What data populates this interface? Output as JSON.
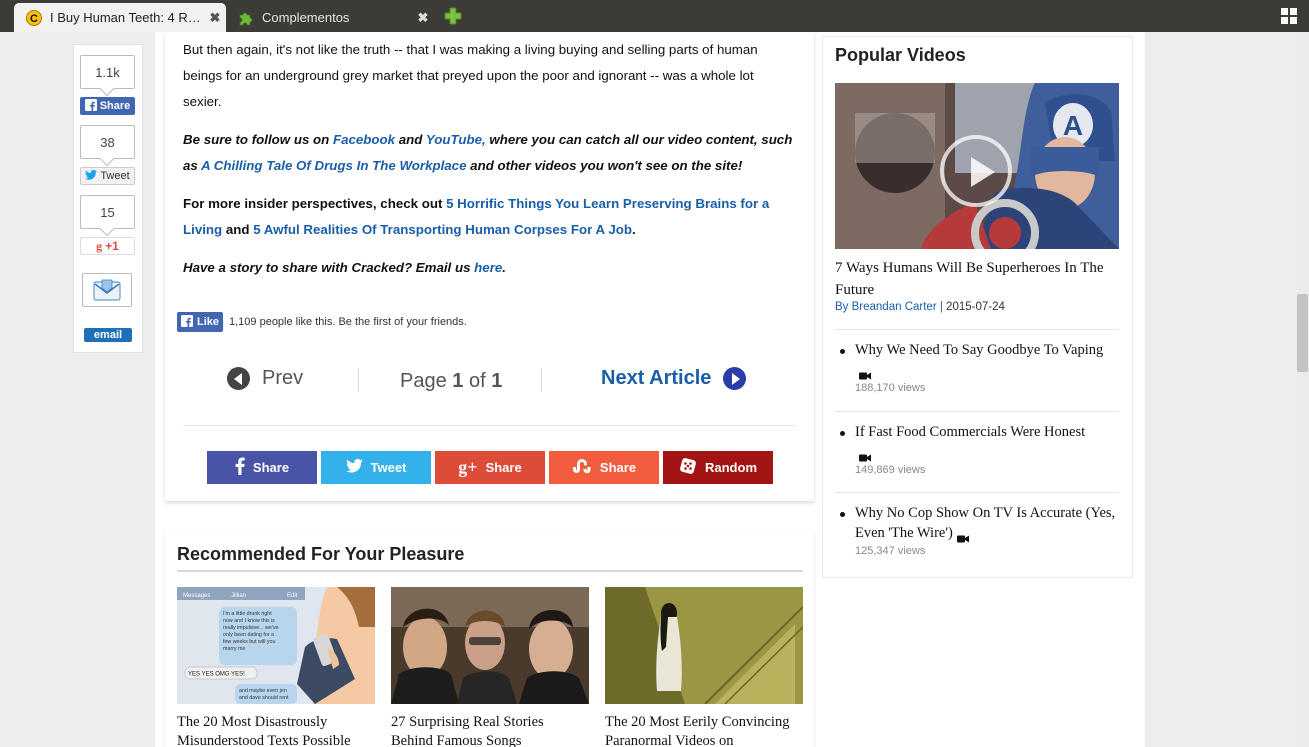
{
  "browser": {
    "tabs": [
      {
        "title": "I Buy Human Teeth: 4 Re...",
        "active": true
      },
      {
        "title": "Complementos",
        "active": false
      }
    ],
    "close_glyph": "✖"
  },
  "share_rail": {
    "facebook": {
      "count": "1.1k",
      "label": "Share"
    },
    "twitter": {
      "count": "38",
      "label": "Tweet"
    },
    "gplus": {
      "count": "15",
      "label": "+1"
    },
    "email": {
      "label": "email"
    }
  },
  "article": {
    "para1": "But then again, it's not like the truth -- that I was making a living buying and selling parts of human beings for an underground grey market that preyed upon the poor and ignorant -- was a whole lot sexier.",
    "follow": {
      "t1": "Be sure to follow us on ",
      "facebook": "Facebook",
      "t2": " and ",
      "youtube": "YouTube,",
      "t3": " where you can catch all our video content, such as ",
      "video": "A Chilling Tale Of Drugs In The Workplace",
      "t4": " and other videos you won't see on the site!"
    },
    "insider": {
      "t1": "For more insider perspectives, check out ",
      "link1": "5 Horrific Things You Learn Preserving Brains for a Living",
      "t2": " and ",
      "link2": "5 Awful Realities Of Transporting Human Corpses For A Job",
      "t3": "."
    },
    "story": {
      "t1": "Have a story to share with Cracked? Email us ",
      "link": "here",
      "t2": "."
    },
    "like": {
      "label": "Like",
      "text": "1,109 people like this. Be the first of your friends."
    },
    "pager": {
      "prev": "Prev",
      "page_prefix": "Page ",
      "page_current": "1",
      "page_mid": " of ",
      "page_total": "1",
      "next": "Next Article"
    },
    "share_bar": {
      "facebook": "Share",
      "twitter": "Tweet",
      "gplus": "Share",
      "stumble": "Share",
      "random": "Random"
    }
  },
  "recommended": {
    "title": "Recommended For Your Pleasure",
    "items": [
      {
        "caption": "The 20 Most Disastrously Misunderstood Texts Possible"
      },
      {
        "caption": "27 Surprising Real Stories Behind Famous Songs"
      },
      {
        "caption": "The 20 Most Eerily Convincing Paranormal Videos on"
      }
    ],
    "phone_texts": {
      "header_left": "Messages",
      "header_name": "Jillian",
      "header_right": "Edit",
      "bubble1": "I'm a little drunk right now and I know this is really impulsive... we've only been dating for a few weeks but will you marry me",
      "bubble2": "YES YES OMG YES!",
      "bubble3": "and maybe even jen and dave should rent"
    }
  },
  "popular_videos": {
    "title": "Popular Videos",
    "featured": {
      "title": "7 Ways Humans Will Be Superheroes In The Future",
      "by": "By ",
      "author": "Breandan Carter",
      "sep": " | ",
      "date": "2015-07-24"
    },
    "items": [
      {
        "title": "Why We Need To Say Goodbye To Vaping",
        "views": "188,170 views"
      },
      {
        "title": "If Fast Food Commercials Were Honest",
        "views": "149,869 views"
      },
      {
        "title": "Why No Cop Show On TV Is Accurate (Yes, Even 'The Wire')",
        "views": "125,347 views"
      }
    ]
  },
  "colors": {
    "facebook": "#4a54a6",
    "twitter": "#33b1ea",
    "gplus": "#dd4b39",
    "stumble": "#f25e3d",
    "random": "#a31515",
    "link": "#1a5ea8"
  }
}
